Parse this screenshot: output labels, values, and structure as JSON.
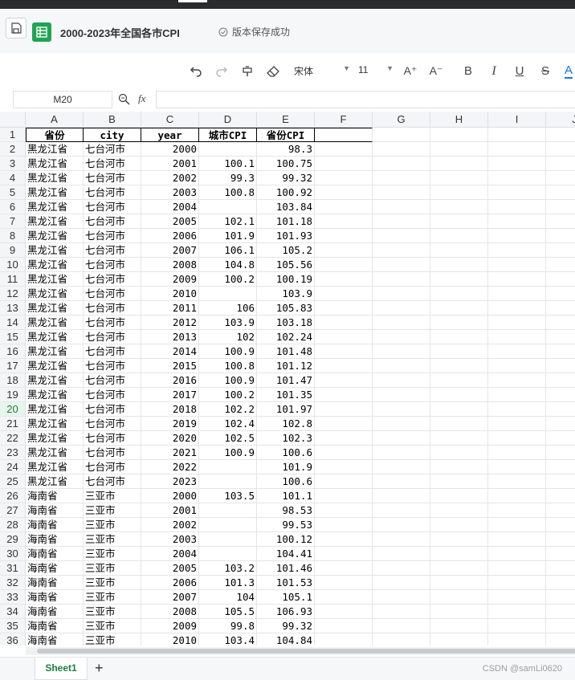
{
  "title_bar": {
    "doc_title": "2000-2023年全国各市CPI",
    "save_status": "版本保存成功"
  },
  "toolbar": {
    "font_name": "宋体",
    "font_size": "11",
    "buttons": [
      "undo-icon",
      "redo-icon",
      "format-painter-icon",
      "eraser-icon",
      "increase-font-icon",
      "decrease-font-icon",
      "bold-icon",
      "italic-icon",
      "underline-icon",
      "strikethrough-icon",
      "font-color-icon"
    ],
    "increase_font_label": "A⁺",
    "decrease_font_label": "A⁻",
    "bold_label": "B",
    "italic_label": "I",
    "underline_label": "U",
    "strike_label": "S",
    "color_label": "A",
    "accent_color": "#1fa454",
    "font_color_bar": "#1a73e8"
  },
  "formula_bar": {
    "cell_ref": "M20",
    "fx_label": "fx",
    "value": ""
  },
  "columns": [
    "A",
    "B",
    "C",
    "D",
    "E",
    "F",
    "G",
    "H",
    "I",
    "J"
  ],
  "selected_row": 20,
  "header_row": [
    "省份",
    "city",
    "year",
    "城市CPI",
    "省份CPI"
  ],
  "rows": [
    [
      "黑龙江省",
      "七台河市",
      "2000",
      "",
      "98.3"
    ],
    [
      "黑龙江省",
      "七台河市",
      "2001",
      "100.1",
      "100.75"
    ],
    [
      "黑龙江省",
      "七台河市",
      "2002",
      "99.3",
      "99.32"
    ],
    [
      "黑龙江省",
      "七台河市",
      "2003",
      "100.8",
      "100.92"
    ],
    [
      "黑龙江省",
      "七台河市",
      "2004",
      "",
      "103.84"
    ],
    [
      "黑龙江省",
      "七台河市",
      "2005",
      "102.1",
      "101.18"
    ],
    [
      "黑龙江省",
      "七台河市",
      "2006",
      "101.9",
      "101.93"
    ],
    [
      "黑龙江省",
      "七台河市",
      "2007",
      "106.1",
      "105.2"
    ],
    [
      "黑龙江省",
      "七台河市",
      "2008",
      "104.8",
      "105.56"
    ],
    [
      "黑龙江省",
      "七台河市",
      "2009",
      "100.2",
      "100.19"
    ],
    [
      "黑龙江省",
      "七台河市",
      "2010",
      "",
      "103.9"
    ],
    [
      "黑龙江省",
      "七台河市",
      "2011",
      "106",
      "105.83"
    ],
    [
      "黑龙江省",
      "七台河市",
      "2012",
      "103.9",
      "103.18"
    ],
    [
      "黑龙江省",
      "七台河市",
      "2013",
      "102",
      "102.24"
    ],
    [
      "黑龙江省",
      "七台河市",
      "2014",
      "100.9",
      "101.48"
    ],
    [
      "黑龙江省",
      "七台河市",
      "2015",
      "100.8",
      "101.12"
    ],
    [
      "黑龙江省",
      "七台河市",
      "2016",
      "100.9",
      "101.47"
    ],
    [
      "黑龙江省",
      "七台河市",
      "2017",
      "100.2",
      "101.35"
    ],
    [
      "黑龙江省",
      "七台河市",
      "2018",
      "102.2",
      "101.97"
    ],
    [
      "黑龙江省",
      "七台河市",
      "2019",
      "102.4",
      "102.8"
    ],
    [
      "黑龙江省",
      "七台河市",
      "2020",
      "102.5",
      "102.3"
    ],
    [
      "黑龙江省",
      "七台河市",
      "2021",
      "100.9",
      "100.6"
    ],
    [
      "黑龙江省",
      "七台河市",
      "2022",
      "",
      "101.9"
    ],
    [
      "黑龙江省",
      "七台河市",
      "2023",
      "",
      "100.6"
    ],
    [
      "海南省",
      "三亚市",
      "2000",
      "103.5",
      "101.1"
    ],
    [
      "海南省",
      "三亚市",
      "2001",
      "",
      "98.53"
    ],
    [
      "海南省",
      "三亚市",
      "2002",
      "",
      "99.53"
    ],
    [
      "海南省",
      "三亚市",
      "2003",
      "",
      "100.12"
    ],
    [
      "海南省",
      "三亚市",
      "2004",
      "",
      "104.41"
    ],
    [
      "海南省",
      "三亚市",
      "2005",
      "103.2",
      "101.46"
    ],
    [
      "海南省",
      "三亚市",
      "2006",
      "101.3",
      "101.53"
    ],
    [
      "海南省",
      "三亚市",
      "2007",
      "104",
      "105.1"
    ],
    [
      "海南省",
      "三亚市",
      "2008",
      "105.5",
      "106.93"
    ],
    [
      "海南省",
      "三亚市",
      "2009",
      "99.8",
      "99.32"
    ],
    [
      "海南省",
      "三亚市",
      "2010",
      "103.4",
      "104.84"
    ]
  ],
  "sheet_bar": {
    "sheet_name": "Sheet1",
    "add_label": "+",
    "watermark": "CSDN @samLi0620"
  }
}
